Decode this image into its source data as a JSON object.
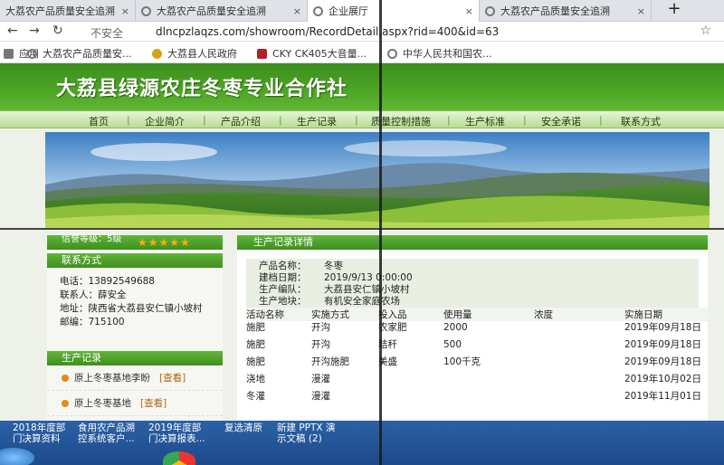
{
  "browser": {
    "tabs": [
      {
        "title": "大荔农产品质量安全追溯"
      },
      {
        "title": "大荔农产品质量安全追溯"
      },
      {
        "title": "企业展厅"
      },
      {
        "title": "大荔农产品质量安全追溯"
      }
    ],
    "tab_close": "×",
    "new_tab": "+",
    "nav": {
      "back": "←",
      "forward": "→",
      "reload": "↻"
    },
    "security_label": "不安全",
    "url": "dlncpzlaqzs.com/showroom/RecordDetail.aspx?rid=400&id=63",
    "bookmarks": [
      {
        "label": "应用"
      },
      {
        "label": "大荔农产品质量安..."
      },
      {
        "label": "大荔县人民政府"
      },
      {
        "label": "CKY CK405大音量..."
      },
      {
        "label": "中华人民共和国农..."
      }
    ]
  },
  "site": {
    "title": "大荔县绿源农庄冬枣专业合作社",
    "nav": [
      "首页",
      "企业简介",
      "产品介绍",
      "生产记录",
      "质量控制措施",
      "生产标准",
      "安全承诺",
      "联系方式"
    ]
  },
  "sidebar": {
    "rating_label": "信誉等级：5级",
    "stars": "★★★★★",
    "contact": {
      "title": "联系方式",
      "phone": "电话：13892549688",
      "person": "联系人：薛安全",
      "address": "地址：陕西省大荔县安仁镇小坡村",
      "postcode": "邮编：715100"
    },
    "records": {
      "title": "生产记录",
      "items": [
        {
          "label": "原上冬枣基地李盼",
          "action": "[查看]"
        },
        {
          "label": "原上冬枣基地",
          "action": "[查看]"
        }
      ]
    }
  },
  "main": {
    "title": "生产记录详情",
    "info": [
      {
        "k": "产品名称：",
        "v": "冬枣"
      },
      {
        "k": "建档日期：",
        "v": "2019/9/13 0:00:00"
      },
      {
        "k": "生产编队：",
        "v": "大荔县安仁镇小坡村"
      },
      {
        "k": "生产地块：",
        "v": "有机安全家庭农场"
      }
    ],
    "table": {
      "headers": [
        "活动名称",
        "实施方式",
        "投入品",
        "使用量",
        "浓度",
        "实施日期"
      ],
      "rows": [
        [
          "施肥",
          "开沟",
          "农家肥",
          "2000",
          "",
          "2019年09月18日"
        ],
        [
          "施肥",
          "开沟",
          "秸秆",
          "500",
          "",
          "2019年09月18日"
        ],
        [
          "施肥",
          "开沟施肥",
          "美盛",
          "100千克",
          "",
          "2019年09月18日"
        ],
        [
          "浇地",
          "漫灌",
          "",
          "",
          "",
          "2019年10月02日"
        ],
        [
          "冬灌",
          "漫灌",
          "",
          "",
          "",
          "2019年11月01日"
        ]
      ]
    }
  },
  "taskbar": {
    "items": [
      {
        "line1": "2018年度部",
        "line2": "门决算资料"
      },
      {
        "line1": "食用农产品溯",
        "line2": "控系统客户..."
      },
      {
        "line1": "2019年度部",
        "line2": "门决算报表..."
      },
      {
        "line1": "复选清原",
        "line2": ""
      },
      {
        "line1": "新建 PPTX 演",
        "line2": "示文稿 (2)"
      }
    ]
  }
}
